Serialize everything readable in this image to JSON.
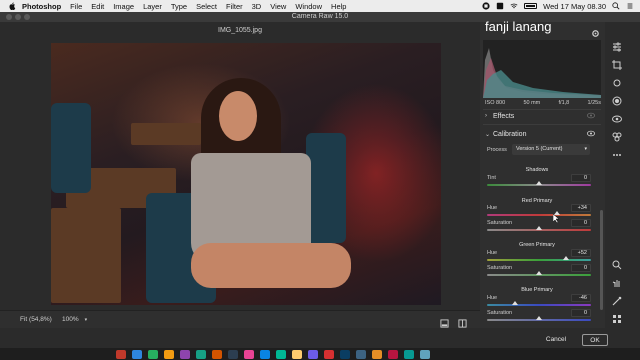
{
  "menubar": {
    "app_name": "Photoshop",
    "items": [
      "File",
      "Edit",
      "Image",
      "Layer",
      "Type",
      "Select",
      "Filter",
      "3D",
      "View",
      "Window",
      "Help"
    ],
    "clock": "Wed 17 May  08.30",
    "icons": [
      "apple-icon",
      "dropbox-icon",
      "tray-icon",
      "wifi-icon",
      "battery-icon",
      "spotlight-icon",
      "notification-icon"
    ]
  },
  "window": {
    "title": "Camera Raw 15.0",
    "filename": "IMG_1055.jpg"
  },
  "overlay_text": "fanji lanang",
  "histogram_info": {
    "iso": "ISO 800",
    "focal": "50 mm",
    "aperture": "f/1,8",
    "shutter": "1/25s"
  },
  "sections": {
    "effects": "Effects",
    "calibration": "Calibration"
  },
  "process": {
    "label": "Process",
    "value": "Version 5 (Current)"
  },
  "calibration": {
    "shadows": {
      "title": "Shadows",
      "tint_label": "Tint",
      "tint_value": "0",
      "tint_level": 0
    },
    "red_primary": {
      "title": "Red Primary",
      "hue_label": "Hue",
      "hue_value": "+34",
      "hue_level": 34,
      "saturation_label": "Saturation",
      "saturation_value": "0",
      "saturation_level": 0
    },
    "green_primary": {
      "title": "Green Primary",
      "hue_label": "Hue",
      "hue_value": "+52",
      "hue_level": 52,
      "saturation_label": "Saturation",
      "saturation_value": "0",
      "saturation_level": 0
    },
    "blue_primary": {
      "title": "Blue Primary",
      "hue_label": "Hue",
      "hue_value": "-46",
      "hue_level": -46,
      "saturation_label": "Saturation",
      "saturation_value": "0",
      "saturation_level": 0
    }
  },
  "bottombar": {
    "fit_label": "Fit (54,8%)",
    "zoom": "100%"
  },
  "buttons": {
    "cancel": "Cancel",
    "ok": "OK"
  },
  "colors": {
    "panel_bg": "#2f2f2f",
    "app_bg": "#2b2b2b",
    "text": "#d6d6d6"
  }
}
